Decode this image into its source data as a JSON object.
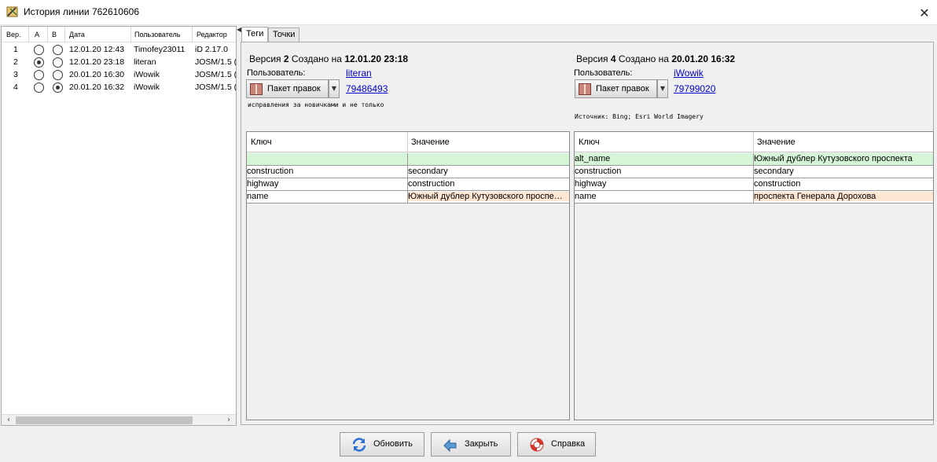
{
  "window": {
    "title": "История линии 762610606",
    "close_glyph": "✕",
    "app_icon": "josm-icon"
  },
  "history": {
    "columns": [
      "Вер.",
      "A",
      "B",
      "Дата",
      "Пользователь",
      "Редактор"
    ],
    "rows": [
      {
        "ver": "1",
        "a": false,
        "b": false,
        "date": "12.01.20 12:43",
        "user": "Timofey23011",
        "editor": "iD 2.17.0"
      },
      {
        "ver": "2",
        "a": true,
        "b": false,
        "date": "12.01.20 23:18",
        "user": "literan",
        "editor": "JOSM/1.5 ("
      },
      {
        "ver": "3",
        "a": false,
        "b": false,
        "date": "20.01.20 16:30",
        "user": "iWowik",
        "editor": "JOSM/1.5 ("
      },
      {
        "ver": "4",
        "a": false,
        "b": true,
        "date": "20.01.20 16:32",
        "user": "iWowik",
        "editor": "JOSM/1.5 ("
      }
    ]
  },
  "tabs": [
    "Теги",
    "Точки"
  ],
  "left_version": {
    "prefix": "Версия ",
    "num": "2",
    "created": " Создано на ",
    "date": "12.01.20 23:18",
    "user_label": "Пользователь:",
    "user": "literan",
    "changeset_btn": "Пакет правок",
    "changeset_id": "79486493",
    "comment": "исправления за новичками и не только"
  },
  "right_version": {
    "prefix": "Версия ",
    "num": "4",
    "created": " Создано на ",
    "date": "20.01.20 16:32",
    "user_label": "Пользователь:",
    "user": "iWowik",
    "changeset_btn": "Пакет правок",
    "changeset_id": "79799020",
    "comment": "Источник: Bing; Esri World Imagery"
  },
  "tag_columns": {
    "key": "Ключ",
    "value": "Значение"
  },
  "left_tags": [
    {
      "k": "",
      "v": "",
      "state": "added"
    },
    {
      "k": "construction",
      "v": "secondary",
      "state": ""
    },
    {
      "k": "highway",
      "v": "construction",
      "state": ""
    },
    {
      "k": "name",
      "v": "Южный дублер Кутузовского проспе…",
      "state": "changed"
    }
  ],
  "right_tags": [
    {
      "k": "alt_name",
      "v": "Южный дублер Кутузовского проспекта",
      "state": "added"
    },
    {
      "k": "construction",
      "v": "secondary",
      "state": ""
    },
    {
      "k": "highway",
      "v": "construction",
      "state": ""
    },
    {
      "k": "name",
      "v": "проспекта Генерала Дорохова",
      "state": "changed"
    }
  ],
  "buttons": {
    "refresh": "Обновить",
    "close": "Закрыть",
    "help": "Справка"
  },
  "colors": {
    "added": "#d6f5d6",
    "changed": "#fde6d2",
    "link": "#0000cc"
  }
}
